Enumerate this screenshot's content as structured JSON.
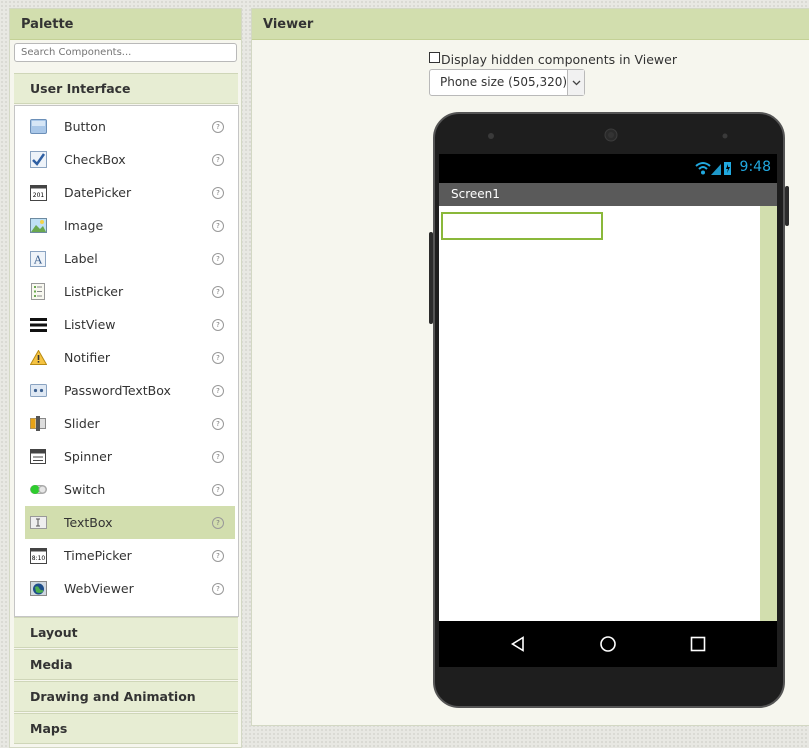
{
  "palette": {
    "title": "Palette",
    "search_placeholder": "Search Components...",
    "drawers": {
      "user_interface": "User Interface",
      "layout": "Layout",
      "media": "Media",
      "drawing": "Drawing and Animation",
      "maps": "Maps"
    },
    "items": [
      {
        "label": "Button",
        "icon": "button-icon"
      },
      {
        "label": "CheckBox",
        "icon": "checkbox-icon"
      },
      {
        "label": "DatePicker",
        "icon": "datepicker-icon"
      },
      {
        "label": "Image",
        "icon": "image-icon"
      },
      {
        "label": "Label",
        "icon": "label-icon"
      },
      {
        "label": "ListPicker",
        "icon": "listpicker-icon"
      },
      {
        "label": "ListView",
        "icon": "listview-icon"
      },
      {
        "label": "Notifier",
        "icon": "notifier-icon"
      },
      {
        "label": "PasswordTextBox",
        "icon": "passwordtextbox-icon"
      },
      {
        "label": "Slider",
        "icon": "slider-icon"
      },
      {
        "label": "Spinner",
        "icon": "spinner-icon"
      },
      {
        "label": "Switch",
        "icon": "switch-icon"
      },
      {
        "label": "TextBox",
        "icon": "textbox-icon",
        "selected": true
      },
      {
        "label": "TimePicker",
        "icon": "timepicker-icon"
      },
      {
        "label": "WebViewer",
        "icon": "webviewer-icon"
      }
    ],
    "help_glyph": "?"
  },
  "viewer": {
    "title": "Viewer",
    "hidden_components_label": "Display hidden components in Viewer",
    "phone_size_selected": "Phone size (505,320)",
    "status_time": "9:48",
    "screen_title": "Screen1"
  },
  "colors": {
    "header_green": "#d2deae",
    "selection_green": "#d2deae",
    "status_blue": "#21a9e0",
    "textbox_border": "#8ab83a"
  }
}
